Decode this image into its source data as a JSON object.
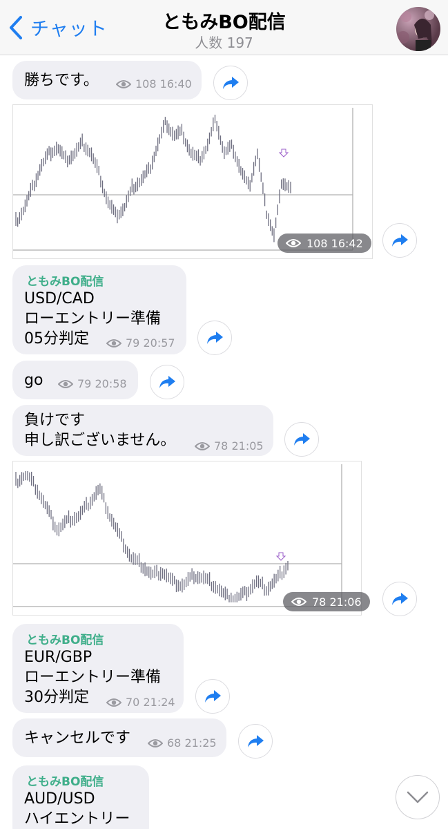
{
  "header": {
    "back_label": "チャット",
    "title": "ともみBO配信",
    "subtitle": "人数 197"
  },
  "messages": {
    "m1": {
      "text": "勝ちです。",
      "views": "108",
      "time": "16:40"
    },
    "chart1": {
      "views": "108",
      "time": "16:42"
    },
    "m2": {
      "sender": "ともみBO配信",
      "text": "USD/CAD\nローエントリー準備\n05分判定",
      "views": "79",
      "time": "20:57"
    },
    "m3": {
      "text": "go",
      "views": "79",
      "time": "20:58"
    },
    "m4": {
      "text": "負けです\n申し訳ございません。",
      "views": "78",
      "time": "21:05"
    },
    "chart2": {
      "views": "78",
      "time": "21:06"
    },
    "m5": {
      "sender": "ともみBO配信",
      "text": "EUR/GBP\nローエントリー準備\n30分判定",
      "views": "70",
      "time": "21:24"
    },
    "m6": {
      "text": "キャンセルです",
      "views": "68",
      "time": "21:25"
    },
    "m7": {
      "sender": "ともみBO配信",
      "text": "AUD/USD\nハイエントリー"
    }
  },
  "colors": {
    "accent": "#1f7ef0",
    "sender": "#3fae8a",
    "bubble": "#efeff4",
    "meta": "#9a9aa0"
  },
  "icons": {
    "back": "chevron-left-icon",
    "views": "eye-icon",
    "share": "share-arrow-icon",
    "scroll": "chevron-down-icon"
  }
}
